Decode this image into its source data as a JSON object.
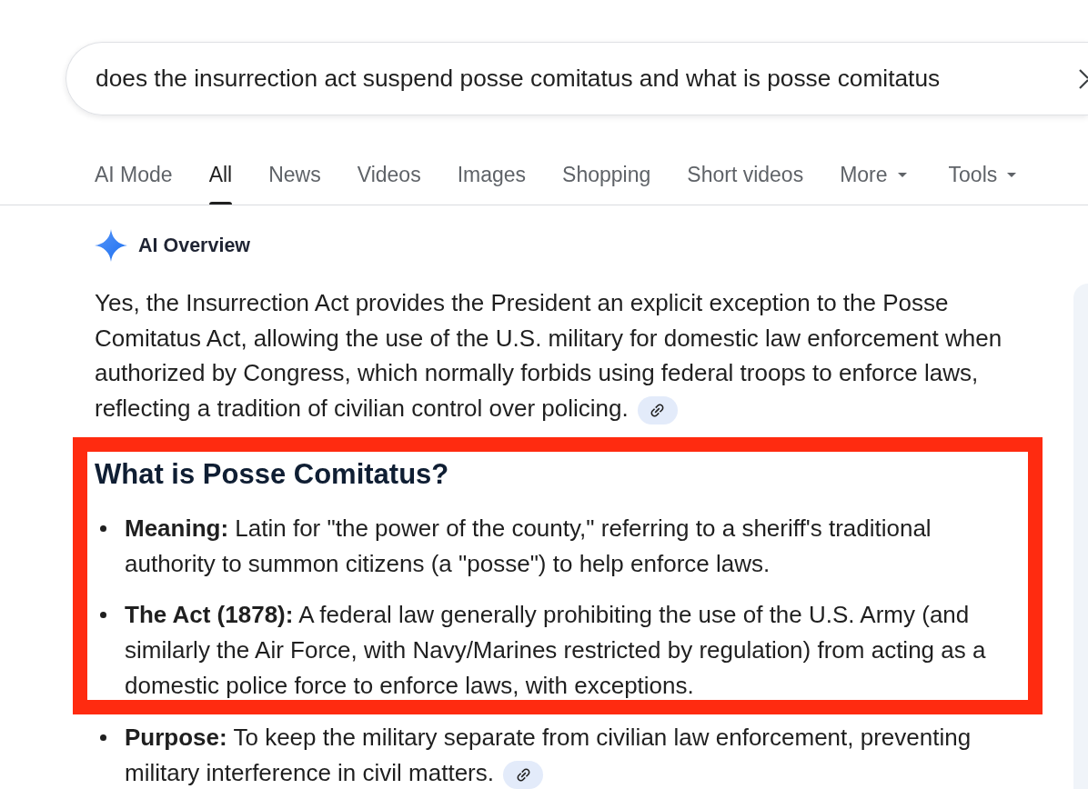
{
  "search": {
    "value": "does the insurrection act suspend posse comitatus and what is posse comitatus"
  },
  "tabs": [
    {
      "label": "AI Mode",
      "selected": false,
      "kind": "link"
    },
    {
      "label": "All",
      "selected": true,
      "kind": "link"
    },
    {
      "label": "News",
      "selected": false,
      "kind": "link"
    },
    {
      "label": "Videos",
      "selected": false,
      "kind": "link"
    },
    {
      "label": "Images",
      "selected": false,
      "kind": "link"
    },
    {
      "label": "Shopping",
      "selected": false,
      "kind": "link"
    },
    {
      "label": "Short videos",
      "selected": false,
      "kind": "link"
    },
    {
      "label": "More",
      "selected": false,
      "kind": "menu"
    },
    {
      "label": "Tools",
      "selected": false,
      "kind": "menu"
    }
  ],
  "ai_overview": {
    "title": "AI Overview",
    "summary": {
      "text": "Yes, the Insurrection Act provides the President an explicit exception to the Posse Comitatus Act, allowing the use of the U.S. military for domestic law enforcement when authorized by Congress, which normally forbids using federal troops to enforce laws, reflecting a tradition of civilian control over policing.",
      "link": true
    },
    "blocks": [
      {
        "kind": "heading",
        "text": "What is Posse Comitatus?",
        "highlighted": true
      },
      {
        "kind": "bullet",
        "text": "**Meaning:** Latin for \"the power of the county,\" referring to a sheriff's traditional authority to summon citizens (a \"posse\") to help enforce laws.",
        "highlighted": true,
        "link": false
      },
      {
        "kind": "bullet",
        "text": "**The Act (1878):** A federal law generally prohibiting the use of the U.S. Army (and similarly the Air Force, with Navy/Marines restricted by regulation) from acting as a domestic police force to enforce laws, with exceptions.",
        "highlighted": true,
        "link": false
      },
      {
        "kind": "bullet",
        "text": "**Purpose:** To keep the military separate from civilian law enforcement, preventing military interference in civil matters.",
        "highlighted": false,
        "link": true
      }
    ]
  }
}
